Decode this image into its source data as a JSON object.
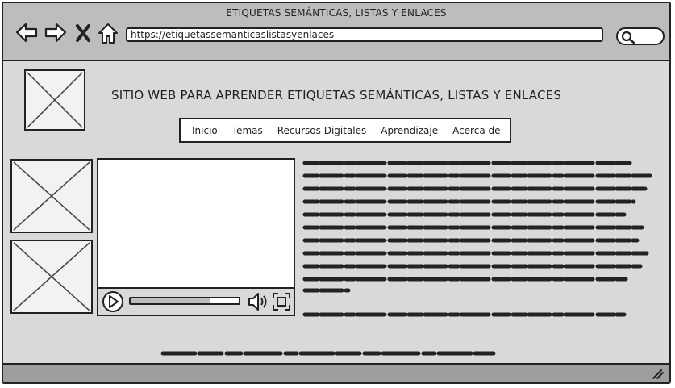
{
  "window": {
    "title": "ETIQUETAS SEMÁNTICAS, LISTAS Y ENLACES"
  },
  "toolbar": {
    "back_icon": "arrow-left-icon",
    "forward_icon": "arrow-right-icon",
    "stop_icon": "close-icon",
    "home_icon": "home-icon",
    "search_icon": "search-icon"
  },
  "address_bar": {
    "url": "https://etiquetassemanticaslistasyenlaces"
  },
  "site": {
    "title": "SITIO WEB PARA APRENDER ETIQUETAS SEMÁNTICAS, LISTAS Y ENLACES"
  },
  "nav": {
    "items": [
      "Inicio",
      "Temas",
      "Recursos Digitales",
      "Aprendizaje",
      "Acerca de"
    ]
  },
  "video": {
    "progress": 0.74
  }
}
